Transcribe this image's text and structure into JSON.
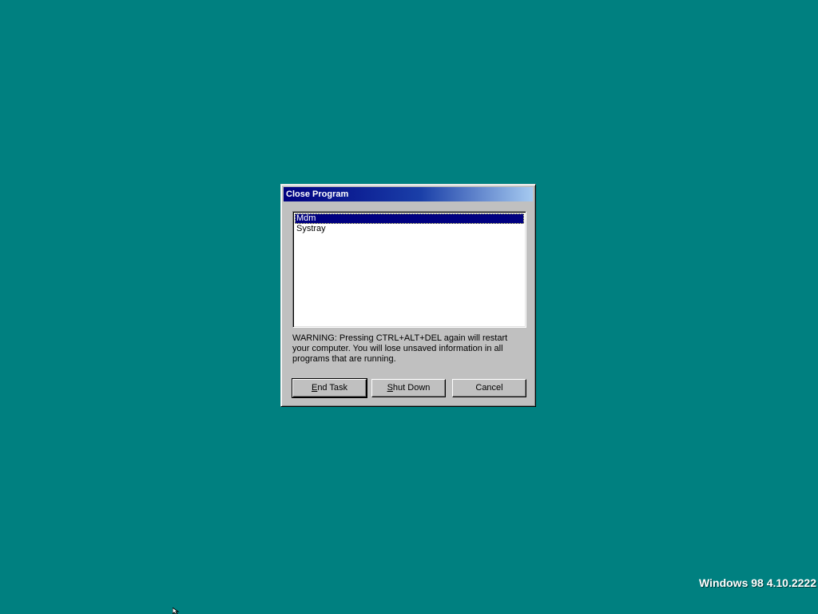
{
  "dialog": {
    "title": "Close Program",
    "list_items": [
      {
        "label": "Mdm",
        "selected": true
      },
      {
        "label": "Systray",
        "selected": false
      }
    ],
    "warning_text": "WARNING: Pressing CTRL+ALT+DEL again will restart your computer. You will lose unsaved information in all programs that are running.",
    "buttons": {
      "end_task": {
        "label": "End Task",
        "mnemonic": "E",
        "rest": "nd Task"
      },
      "shut_down": {
        "label": "Shut Down",
        "mnemonic": "S",
        "rest": "hut Down"
      },
      "cancel": {
        "label": "Cancel"
      }
    }
  },
  "desktop": {
    "version_text": "Windows 98 4.10.2222",
    "background_color": "#008080"
  },
  "colors": {
    "title_start": "#000080",
    "title_end": "#a6caf0",
    "selection": "#000080",
    "face": "#c0c0c0"
  },
  "icons": {
    "cursor": "arrow-cursor-icon"
  }
}
